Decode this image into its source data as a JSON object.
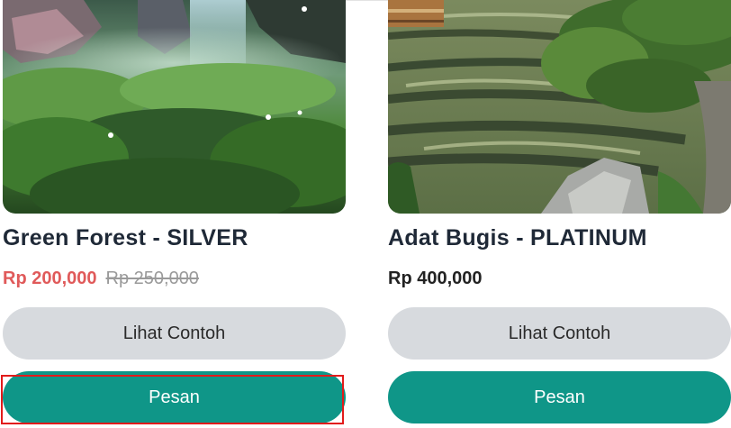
{
  "products": [
    {
      "image_icon": "forest-landscape-image",
      "title": "Green Forest - SILVER",
      "price": "Rp 200,000",
      "old_price": "Rp 250,000",
      "preview_label": "Lihat Contoh",
      "order_label": "Pesan"
    },
    {
      "image_icon": "river-landscape-image",
      "title": "Adat Bugis - PLATINUM",
      "price": "Rp 400,000",
      "old_price": "",
      "preview_label": "Lihat Contoh",
      "order_label": "Pesan"
    }
  ],
  "colors": {
    "primary": "#0f9688",
    "secondary_button": "#d7dade",
    "sale_price": "#e05a5a",
    "highlight": "#e21b1b"
  }
}
